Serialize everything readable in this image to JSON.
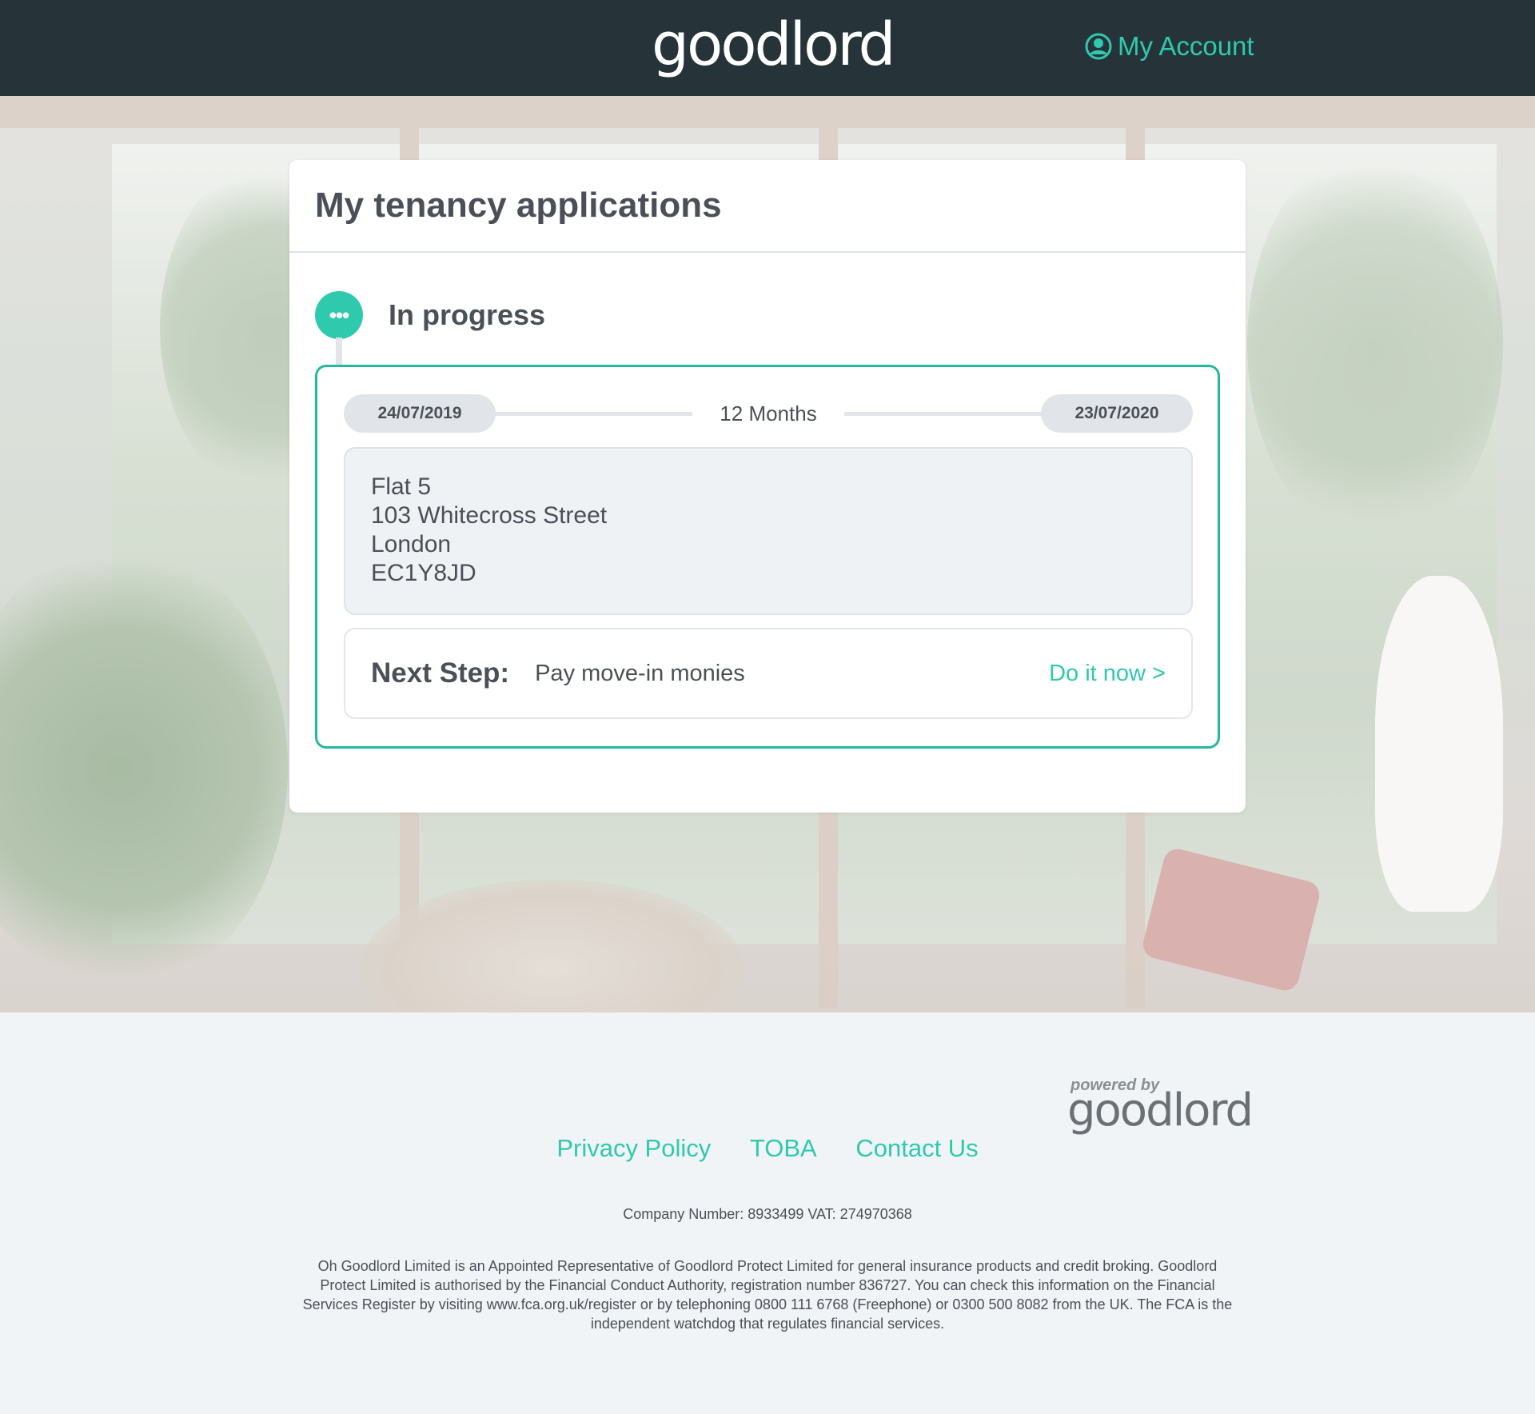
{
  "header": {
    "logo": "goodlord",
    "account_label": "My Account"
  },
  "card": {
    "title": "My tenancy applications",
    "status": {
      "dot_label": "•••",
      "label": "In progress"
    },
    "application": {
      "start_date": "24/07/2019",
      "duration": "12 Months",
      "end_date": "23/07/2020",
      "address": {
        "line1": "Flat 5",
        "line2": "103 Whitecross Street",
        "line3": "London",
        "line4": "EC1Y8JD"
      },
      "next_step": {
        "label": "Next Step:",
        "value": "Pay move-in monies",
        "action": "Do it now >"
      }
    }
  },
  "footer": {
    "powered_by": "powered by",
    "powered_logo": "goodlord",
    "links": {
      "privacy": "Privacy Policy",
      "toba": "TOBA",
      "contact": "Contact Us"
    },
    "company": "Company Number: 8933499 VAT: 274970368",
    "legal": "Oh Goodlord Limited is an Appointed Representative of Goodlord Protect Limited for general insurance products and credit broking. Goodlord Protect Limited is authorised by the Financial Conduct Authority, registration number 836727. You can check this information on the Financial Services Register by visiting www.fca.org.uk/register or by telephoning 0800 111 6768 (Freephone) or 0300 500 8082 from the UK. The FCA is the independent watchdog that regulates financial services."
  },
  "colors": {
    "header_bg": "#263439",
    "accent": "#2fc9ad",
    "text": "#4b5058",
    "footer_bg": "#f0f4f7"
  }
}
